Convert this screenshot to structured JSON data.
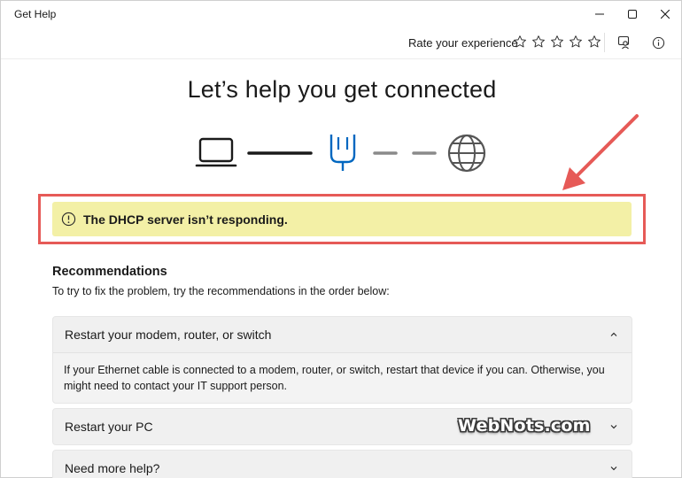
{
  "window": {
    "title": "Get Help"
  },
  "toolbar": {
    "rate_label": "Rate your experience",
    "stars": [
      {
        "icon": "star-outline-icon"
      },
      {
        "icon": "star-outline-icon"
      },
      {
        "icon": "star-outline-icon"
      },
      {
        "icon": "star-outline-icon"
      },
      {
        "icon": "star-outline-icon"
      }
    ],
    "feedback_icon": "feedback-icon",
    "info_icon": "info-icon"
  },
  "main": {
    "title": "Let’s help you get connected",
    "diagram": {
      "icons": [
        "laptop-icon",
        "ethernet-plug-icon",
        "globe-icon"
      ],
      "accent_color": "#0067c0"
    },
    "alert": {
      "text": "The DHCP server isn’t responding.",
      "background": "#f3f0a6",
      "highlight_color": "#e65a57"
    },
    "recommendations": {
      "heading": "Recommendations",
      "subtext": "To try to fix the problem, try the recommendations in the order below:",
      "items": [
        {
          "title": "Restart your modem, router, or switch",
          "expanded": true,
          "body": "If your Ethernet cable is connected to a modem, router, or switch, restart that device if you can. Otherwise, you might need to contact your IT support person."
        },
        {
          "title": "Restart your PC",
          "expanded": false
        },
        {
          "title": "Need more help?",
          "expanded": false
        }
      ]
    }
  },
  "watermark": {
    "text": "WebNots.com"
  }
}
